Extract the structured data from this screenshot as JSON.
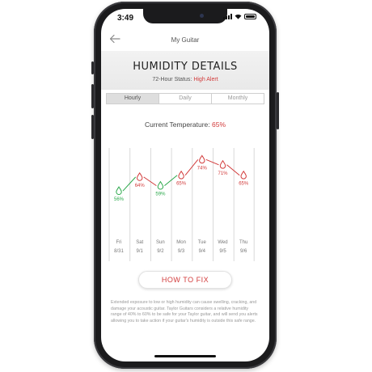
{
  "status_bar": {
    "time": "3:49"
  },
  "nav": {
    "title": "My Guitar"
  },
  "header": {
    "title": "HUMIDITY DETAILS",
    "status_label": "72-Hour Status:",
    "status_value": "High Alert"
  },
  "tabs": [
    {
      "label": "Hourly",
      "active": true
    },
    {
      "label": "Daily",
      "active": false
    },
    {
      "label": "Monthly",
      "active": false
    }
  ],
  "current_temperature": {
    "label": "Current Temperature:",
    "value": "65%"
  },
  "colors": {
    "alert_red": "#d23b3b",
    "ok_green": "#2aa84a",
    "line_gray": "#d9d9d9"
  },
  "chart_data": {
    "type": "line",
    "categories": [
      "Fri 8/31",
      "Sat 9/1",
      "Sun 9/2",
      "Mon 9/3",
      "Tue 9/4",
      "Wed 9/5",
      "Thu 9/6"
    ],
    "days": [
      "Fri",
      "Sat",
      "Sun",
      "Mon",
      "Tue",
      "Wed",
      "Thu"
    ],
    "dates": [
      "8/31",
      "9/1",
      "9/2",
      "9/3",
      "9/4",
      "9/5",
      "9/6"
    ],
    "values": [
      56,
      64,
      59,
      65,
      74,
      71,
      65
    ],
    "labels": [
      "56%",
      "64%",
      "59%",
      "65%",
      "74%",
      "71%",
      "65%"
    ],
    "status": [
      "ok",
      "alert",
      "ok",
      "alert",
      "alert",
      "alert",
      "alert"
    ],
    "ylim": [
      50,
      80
    ],
    "icon": "water-drop-icon"
  },
  "action": {
    "label": "HOW TO FIX"
  },
  "description": "Extended exposure to low or high humidity can cause swelling, cracking, and damage your acoustic guitar. Taylor Guitars considers a relative humidity range of 40% to 60% to be safe for your Taylor guitar, and will send you alerts allowing you to take action if your guitar's humidity is outside this safe range."
}
